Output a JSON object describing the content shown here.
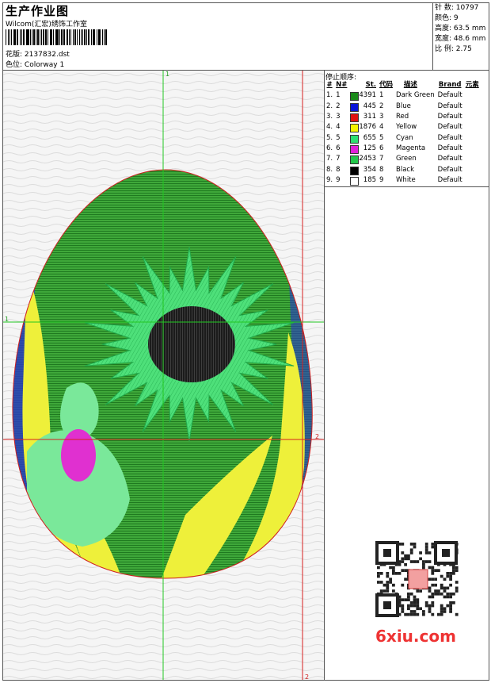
{
  "header": {
    "title": "生产作业图",
    "company": "Wilcom(汇宏)绣饰工作室",
    "design_label": "花版:",
    "design_value": "2137832.dst",
    "colorway_label": "色位:",
    "colorway_value": "Colorway 1"
  },
  "stats": [
    {
      "label": "针 数:",
      "value": "10797"
    },
    {
      "label": "颜色:",
      "value": "9"
    },
    {
      "label": "高度:",
      "value": "63.5 mm"
    },
    {
      "label": "宽度:",
      "value": "48.6 mm"
    },
    {
      "label": "比 例:",
      "value": "2.75"
    }
  ],
  "stop_sequence": {
    "title": "停止顺序:",
    "columns": [
      "#",
      "N#",
      "St.",
      "代码",
      "描述",
      "Brand",
      "元素"
    ],
    "rows": [
      {
        "num": "1.",
        "n": "1",
        "color": "#1a8a1a",
        "st": "4391",
        "code": "1",
        "desc": "Dark Green",
        "brand": "Default"
      },
      {
        "num": "2.",
        "n": "2",
        "color": "#0a14d8",
        "st": "445",
        "code": "2",
        "desc": "Blue",
        "brand": "Default"
      },
      {
        "num": "3.",
        "n": "3",
        "color": "#e01010",
        "st": "311",
        "code": "3",
        "desc": "Red",
        "brand": "Default"
      },
      {
        "num": "4.",
        "n": "4",
        "color": "#f4f400",
        "st": "1876",
        "code": "4",
        "desc": "Yellow",
        "brand": "Default"
      },
      {
        "num": "5.",
        "n": "5",
        "color": "#2ee070",
        "st": "655",
        "code": "5",
        "desc": "Cyan",
        "brand": "Default"
      },
      {
        "num": "6.",
        "n": "6",
        "color": "#e020d8",
        "st": "125",
        "code": "6",
        "desc": "Magenta",
        "brand": "Default"
      },
      {
        "num": "7.",
        "n": "7",
        "color": "#22c84a",
        "st": "2453",
        "code": "7",
        "desc": "Green",
        "brand": "Default"
      },
      {
        "num": "8.",
        "n": "8",
        "color": "#000000",
        "st": "354",
        "code": "8",
        "desc": "Black",
        "brand": "Default"
      },
      {
        "num": "9.",
        "n": "9",
        "color": "#ffffff",
        "st": "185",
        "code": "9",
        "desc": "White",
        "brand": "Default"
      }
    ]
  },
  "guides": {
    "top": "1",
    "left": "1",
    "bottom": "2",
    "right": "2"
  },
  "watermark": {
    "text": "6xiu.com"
  }
}
